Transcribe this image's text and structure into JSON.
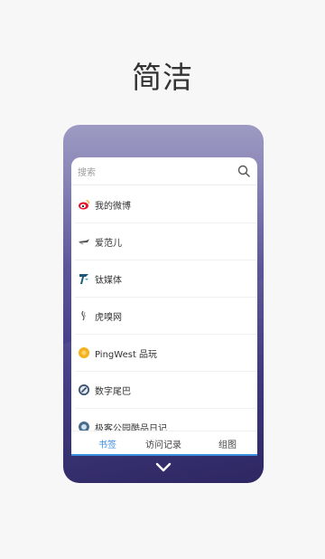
{
  "headline": "简洁",
  "search": {
    "placeholder": "搜索",
    "icon": "search-icon"
  },
  "bookmarks": [
    {
      "label": "我的微博",
      "icon": "weibo-icon"
    },
    {
      "label": "爱范儿",
      "icon": "ifanr-icon"
    },
    {
      "label": "钛媒体",
      "icon": "tmtpost-icon"
    },
    {
      "label": "虎嗅网",
      "icon": "huxiu-icon"
    },
    {
      "label": "PingWest 品玩",
      "icon": "pingwest-icon"
    },
    {
      "label": "数字尾巴",
      "icon": "dgtle-icon"
    },
    {
      "label": "极客公园酷品日记",
      "icon": "geekpark-icon"
    }
  ],
  "tabs": [
    {
      "label": "书签",
      "active": true
    },
    {
      "label": "访问记录",
      "active": false
    },
    {
      "label": "组图",
      "active": false
    }
  ],
  "colors": {
    "accent": "#3b8de0",
    "phone_top": "#9d9bc3",
    "phone_bottom": "#2e2769"
  },
  "collapse_icon": "chevron-down-icon"
}
